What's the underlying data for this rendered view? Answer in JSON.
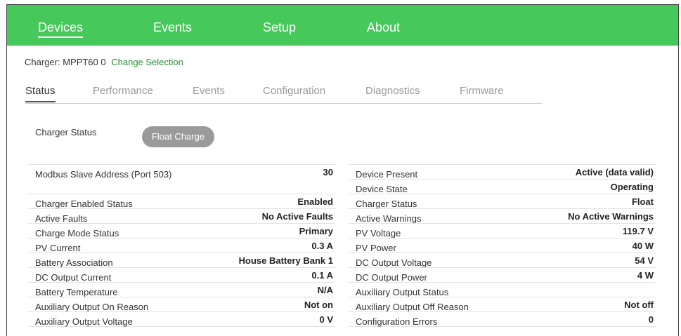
{
  "nav": {
    "items": [
      {
        "label": "Devices",
        "active": true
      },
      {
        "label": "Events",
        "active": false
      },
      {
        "label": "Setup",
        "active": false
      },
      {
        "label": "About",
        "active": false
      }
    ]
  },
  "charger": {
    "label": "Charger: MPPT60 0",
    "change_link": "Change Selection"
  },
  "tabs": [
    {
      "label": "Status",
      "active": true
    },
    {
      "label": "Performance",
      "active": false
    },
    {
      "label": "Events",
      "active": false
    },
    {
      "label": "Configuration",
      "active": false
    },
    {
      "label": "Diagnostics",
      "active": false
    },
    {
      "label": "Firmware",
      "active": false
    }
  ],
  "status": {
    "label": "Charger Status",
    "value": "Float Charge"
  },
  "left_table": [
    {
      "label": "Modbus Slave Address (Port 503)",
      "value": "30"
    },
    {
      "label": "Charger Enabled Status",
      "value": "Enabled"
    },
    {
      "label": "Active Faults",
      "value": "No Active Faults"
    },
    {
      "label": "Charge Mode Status",
      "value": "Primary"
    },
    {
      "label": "PV Current",
      "value": "0.3 A"
    },
    {
      "label": "Battery Association",
      "value": "House Battery Bank 1"
    },
    {
      "label": "DC Output Current",
      "value": "0.1 A"
    },
    {
      "label": "Battery Temperature",
      "value": "N/A"
    },
    {
      "label": "Auxiliary Output On Reason",
      "value": "Not on"
    },
    {
      "label": "Auxiliary Output Voltage",
      "value": "0 V"
    }
  ],
  "right_table": [
    {
      "label": "Device Present",
      "value": "Active (data valid)"
    },
    {
      "label": "Device State",
      "value": "Operating"
    },
    {
      "label": "Charger Status",
      "value": "Float"
    },
    {
      "label": "Active Warnings",
      "value": "No Active Warnings"
    },
    {
      "label": "PV Voltage",
      "value": "119.7 V"
    },
    {
      "label": "PV Power",
      "value": "40 W"
    },
    {
      "label": "DC Output Voltage",
      "value": "54 V"
    },
    {
      "label": "DC Output Power",
      "value": "4 W"
    },
    {
      "label": "Auxiliary Output Status",
      "value": ""
    },
    {
      "label": "Auxiliary Output Off Reason",
      "value": "Not off"
    },
    {
      "label": "Configuration Errors",
      "value": "0"
    }
  ],
  "colors": {
    "navbar": "#46c85a",
    "link": "#2e8b3a",
    "pill": "#9a9a9a"
  }
}
